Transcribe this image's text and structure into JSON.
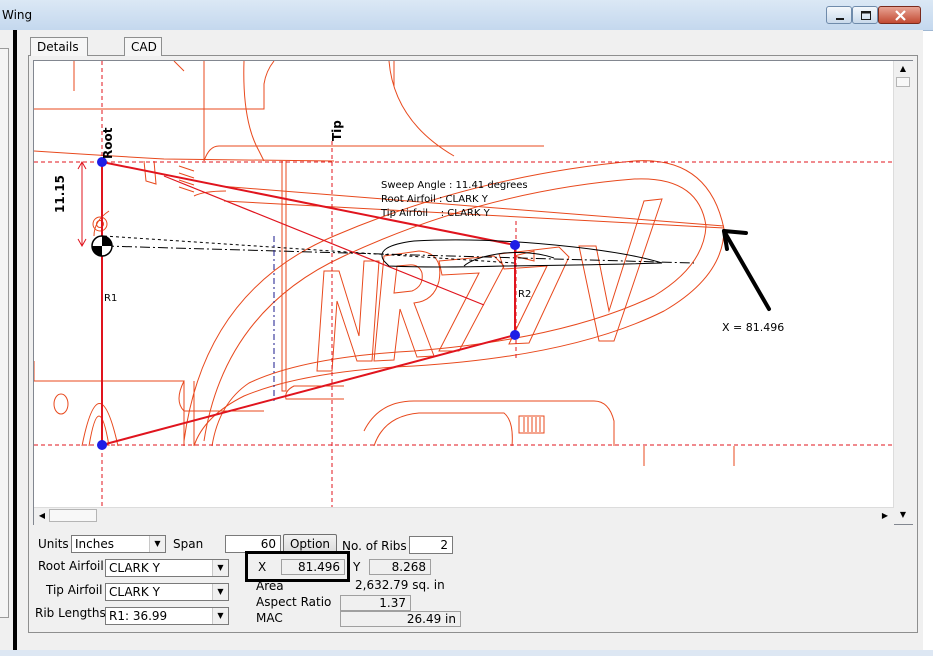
{
  "window": {
    "title": "Wing",
    "controls": {
      "minimize": "minimize",
      "maximize": "maximize",
      "close": "close"
    }
  },
  "tabs": [
    {
      "label": "Details",
      "active": false
    },
    {
      "label": "CAD",
      "active": true
    }
  ],
  "cad": {
    "labels": {
      "root": "Root",
      "tip": "Tip",
      "root_chord_dim": "11.15",
      "rib1": "R1",
      "rib2": "R2",
      "registration": "NR77V",
      "x_annotation": "X = 81.496"
    },
    "info_box": [
      "Sweep Angle : 11.41 degrees",
      "Root Airfoil : CLARK Y",
      "Tip Airfoil    : CLARK Y"
    ],
    "colors": {
      "background_drawing": "#e8491d",
      "wing_outline": "#e0141e",
      "guide_lines": "#e0141e",
      "rib_points": "#1e1ee6",
      "airfoil": "#000000",
      "arrow": "#000000"
    }
  },
  "form": {
    "units_label": "Units",
    "units_value": "Inches",
    "span_label": "Span",
    "span_value": "60",
    "option_button": "Option",
    "ribs_label": "No. of Ribs",
    "ribs_value": "2",
    "root_airfoil_label": "Root Airfoil",
    "root_airfoil_value": "CLARK Y",
    "tip_airfoil_label": "Tip Airfoil",
    "tip_airfoil_value": "CLARK Y",
    "rib_lengths_label": "Rib Lengths",
    "rib_lengths_value": "R1: 36.99",
    "x_label": "X",
    "x_value": "81.496",
    "y_label": "Y",
    "y_value": "8.268",
    "area_label": "Area",
    "area_value": "2,632.79 sq. in",
    "aspect_label": "Aspect Ratio",
    "aspect_value": "1.37",
    "mac_label": "MAC",
    "mac_value": "26.49 in"
  }
}
